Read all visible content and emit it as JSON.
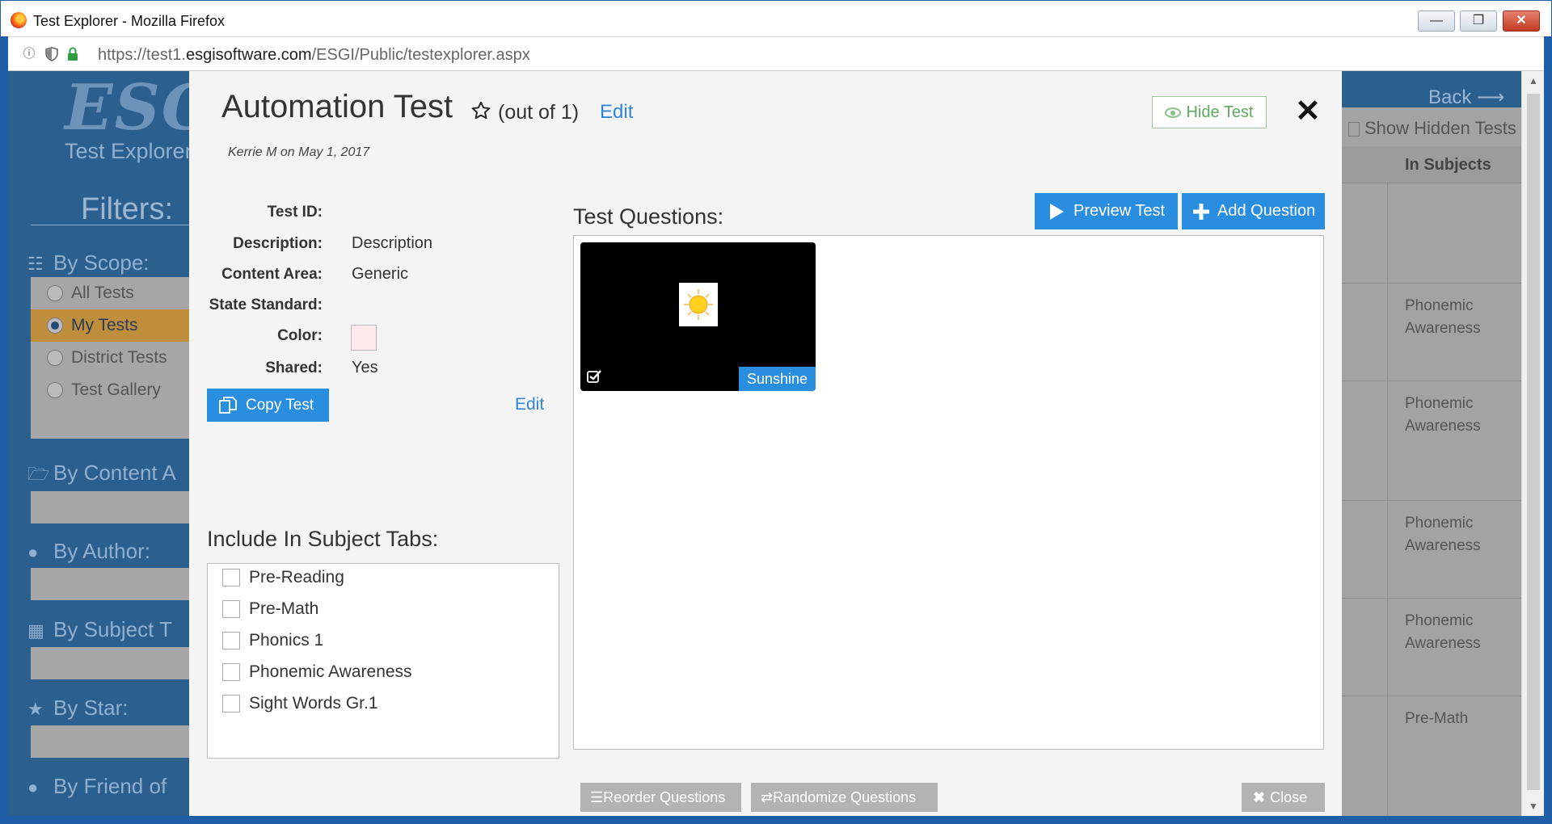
{
  "window": {
    "title": "Test Explorer - Mozilla Firefox",
    "url_prefix": "https://test1.",
    "url_domain": "esgisoftware.com",
    "url_path": "/ESGI/Public/testexplorer.aspx"
  },
  "background": {
    "logo": "ESGI",
    "logo_sub": "Test Explorer",
    "filters_title": "Filters:",
    "back_label": "Back ⟶",
    "show_hidden_label": "Show Hidden Tests",
    "col_in_subjects": "In Subjects",
    "sections": [
      {
        "icon": "sitemap-icon",
        "label": "By Scope:"
      },
      {
        "icon": "folder-open-icon",
        "label": "By Content A"
      },
      {
        "icon": "user-icon",
        "label": "By Author:"
      },
      {
        "icon": "book-icon",
        "label": "By Subject T"
      },
      {
        "icon": "star-icon",
        "label": "By Star:"
      },
      {
        "icon": "users-icon",
        "label": "By Friend of"
      }
    ],
    "scopes": [
      {
        "label": "All Tests",
        "selected": false
      },
      {
        "label": "My Tests",
        "selected": true
      },
      {
        "label": "District Tests",
        "selected": false
      },
      {
        "label": "Test Gallery",
        "selected": false
      }
    ],
    "subject_cells": [
      "",
      "Phonemic Awareness",
      "Phonemic Awareness",
      "Phonemic Awareness",
      "Phonemic Awareness",
      "Pre-Math"
    ]
  },
  "modal": {
    "title": "Automation Test",
    "out_of": "(out of 1)",
    "edit_label": "Edit",
    "author": "Kerrie M on May 1, 2017",
    "hide_test_label": "Hide Test",
    "close_x": "✕",
    "fields": {
      "test_id_label": "Test ID:",
      "test_id_value": "",
      "description_label": "Description:",
      "description_value": "Description",
      "content_area_label": "Content Area:",
      "content_area_value": "Generic",
      "state_standard_label": "State Standard:",
      "state_standard_value": "",
      "color_label": "Color:",
      "color_value": "#fde8ea",
      "shared_label": "Shared:",
      "shared_value": "Yes"
    },
    "copy_test_label": "Copy Test",
    "edit_details_label": "Edit",
    "subject_tabs_title": "Include In Subject Tabs:",
    "subject_tabs": [
      {
        "label": "Pre-Reading",
        "checked": false
      },
      {
        "label": "Pre-Math",
        "checked": false
      },
      {
        "label": "Phonics 1",
        "checked": false
      },
      {
        "label": "Phonemic Awareness",
        "checked": false
      },
      {
        "label": "Sight Words Gr.1",
        "checked": false
      }
    ],
    "test_questions_title": "Test Questions:",
    "preview_test_label": "Preview Test",
    "add_question_label": "Add Question",
    "questions": [
      {
        "label": "Sunshine",
        "image": "sun-icon",
        "selected": true
      }
    ],
    "reorder_label": "Reorder Questions",
    "randomize_label": "Randomize Questions",
    "close_label": "Close"
  },
  "colors": {
    "accent": "#2a8ee0",
    "link": "#2e86d9",
    "hide_green": "#5fa95f",
    "background_blue": "#2b5f8e"
  }
}
